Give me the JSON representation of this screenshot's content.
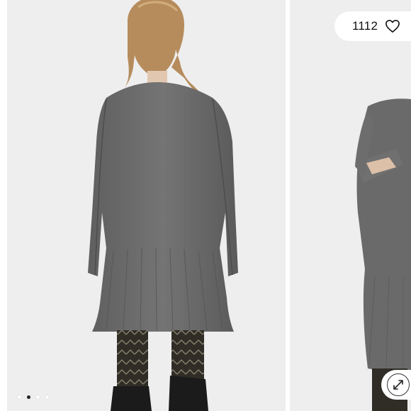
{
  "gallery": {
    "like_count": "1112",
    "like_icon": "heart-outline-icon",
    "expand_icon": "expand-arrows-icon",
    "pagination": {
      "total": 4,
      "active_index": 1
    }
  },
  "colors": {
    "sweater": "#6b6b6b",
    "backdrop": "#eeeeee",
    "tights": "#2e2c25",
    "hair": "#b68c5d"
  }
}
